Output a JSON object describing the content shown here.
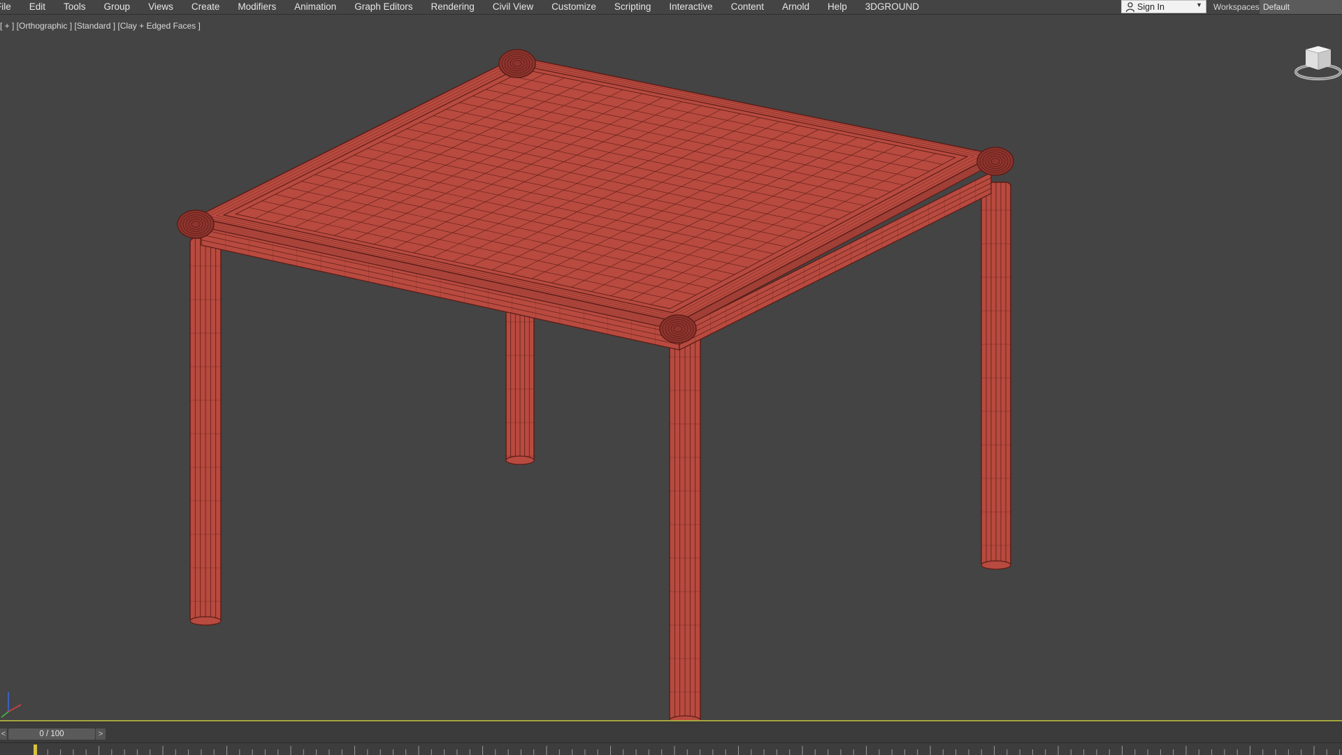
{
  "menubar": {
    "items": [
      "File",
      "Edit",
      "Tools",
      "Group",
      "Views",
      "Create",
      "Modifiers",
      "Animation",
      "Graph Editors",
      "Rendering",
      "Civil View",
      "Customize",
      "Scripting",
      "Interactive",
      "Content",
      "Arnold",
      "Help",
      "3DGROUND"
    ],
    "sign_in": "Sign In",
    "workspaces_label": "Workspaces:",
    "workspaces_value": "Default"
  },
  "viewport": {
    "label": "[ + ] [Orthographic ] [Standard ] [Clay + Edged Faces ]",
    "object_color": "#b84a3f",
    "wire_color": "#5a1d18",
    "background": "#444444"
  },
  "timeline": {
    "prev": "<",
    "frame": "0 / 100",
    "next": ">",
    "current_frame": 0,
    "total_frames": 100
  },
  "icons": {
    "viewcube": "viewcube-icon",
    "axis": "axis-tripod-icon",
    "user": "user-icon"
  }
}
